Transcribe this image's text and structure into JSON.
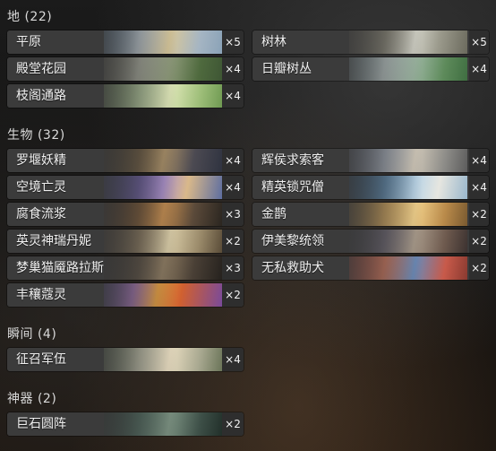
{
  "sections": {
    "lands": {
      "title": "地 (22)"
    },
    "creatures": {
      "title": "生物 (32)"
    },
    "instants": {
      "title": "瞬间 (4)"
    },
    "artifacts": {
      "title": "神器 (2)"
    }
  },
  "cards": {
    "plains": {
      "name": "平原",
      "count": "×5"
    },
    "forest": {
      "name": "树林",
      "count": "×5"
    },
    "temple_garden": {
      "name": "殿堂花园",
      "count": "×4"
    },
    "sunpetal_grove": {
      "name": "日瓣树丛",
      "count": "×4"
    },
    "branchloft_pathway": {
      "name": "枝阁通路",
      "count": "×4"
    },
    "thalia_elf": {
      "name": "罗堰妖精",
      "count": "×4"
    },
    "thalia_guardian": {
      "name": "辉侯求索客",
      "count": "×4"
    },
    "voidling": {
      "name": "空境亡灵",
      "count": "×4"
    },
    "elite_cleric": {
      "name": "精英锁咒僧",
      "count": "×4"
    },
    "ooze": {
      "name": "腐食流浆",
      "count": "×3"
    },
    "gold_bird": {
      "name": "金鹊",
      "count": "×2"
    },
    "hero_danny": {
      "name": "英灵神瑞丹妮",
      "count": "×2"
    },
    "imeleader": {
      "name": "伊美黎统领",
      "count": "×2"
    },
    "dream_cat": {
      "name": "梦巢猫魇路拉斯",
      "count": "×3"
    },
    "selfless_dog": {
      "name": "无私救助犬",
      "count": "×2"
    },
    "harvest_spirit": {
      "name": "丰穰蔻灵",
      "count": "×2"
    },
    "recruit_army": {
      "name": "征召军伍",
      "count": "×4"
    },
    "stone_circle": {
      "name": "巨石圆阵",
      "count": "×2"
    }
  },
  "colors": {
    "card_bg": "#3b3b3b",
    "count_bg": "#2e2e2e",
    "text": "#f0f0f0"
  }
}
